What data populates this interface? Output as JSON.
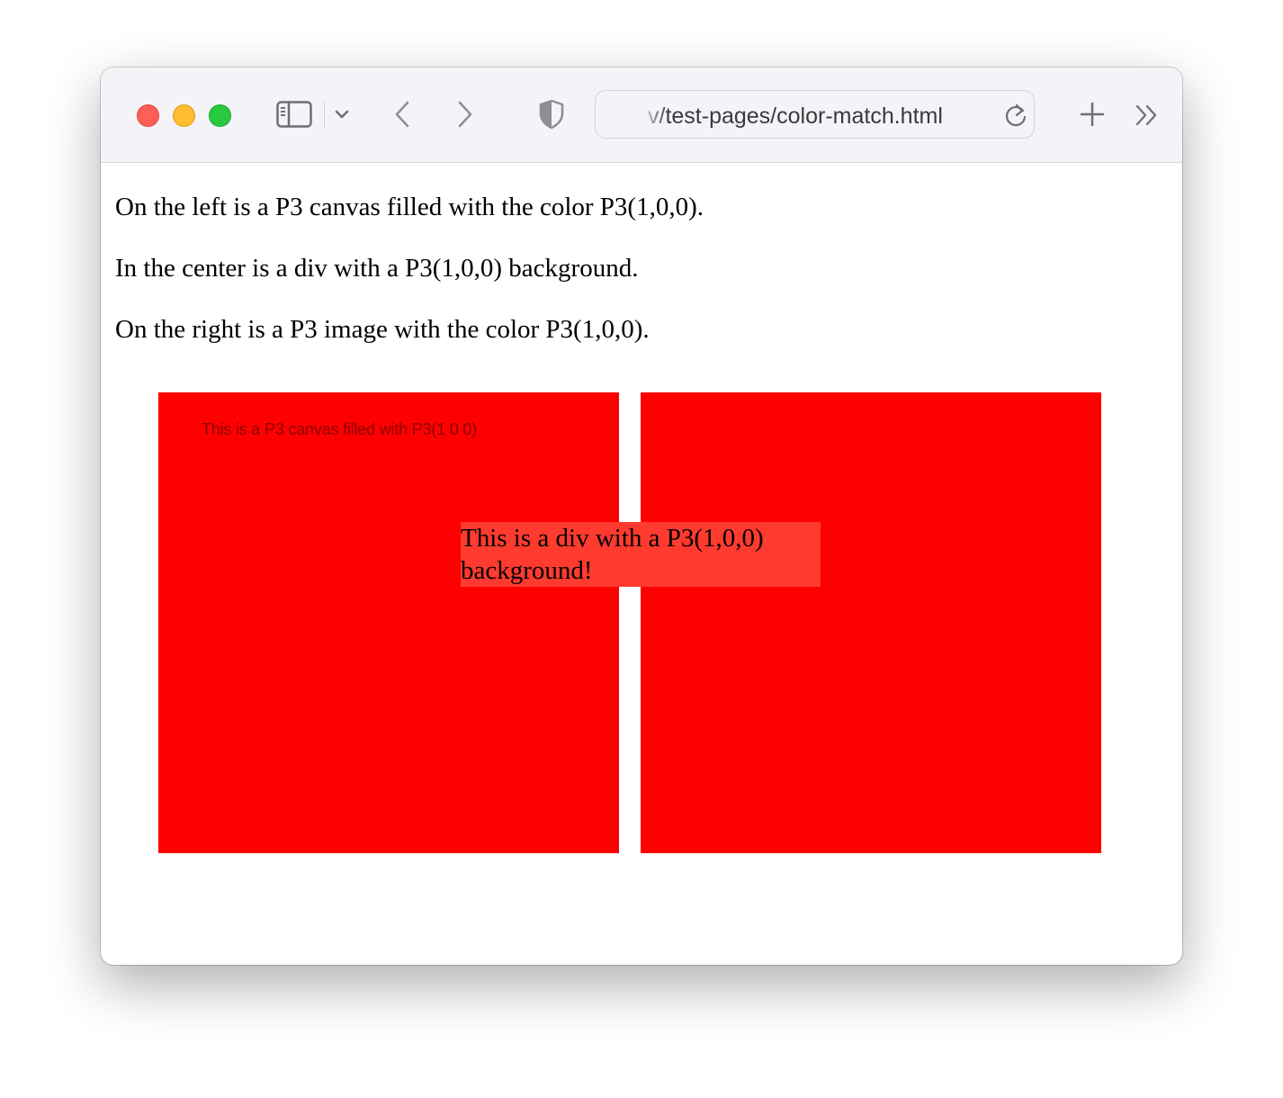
{
  "browser": {
    "url_display": "v/test-pages/color-match.html",
    "icons": {
      "sidebar": "sidebar-icon",
      "chevron": "chevron-down-icon",
      "back": "back-icon",
      "forward": "forward-icon",
      "privacy": "shield-icon",
      "reload": "reload-icon",
      "new_tab": "plus-icon",
      "more": "double-chevron-icon"
    }
  },
  "page": {
    "paragraphs": [
      "On the left is a P3 canvas filled with the color P3(1,0,0).",
      "In the center is a div with a P3(1,0,0) background.",
      "On the right is a P3 image with the color P3(1,0,0)."
    ],
    "canvas_text": "This is a P3 canvas filled with P3(1 0 0)",
    "div_text": "This is a div with a P3(1,0,0) background!",
    "colors": {
      "canvas": "#ff0000",
      "div": "#ff3a2e",
      "image": "#ff0000"
    }
  }
}
